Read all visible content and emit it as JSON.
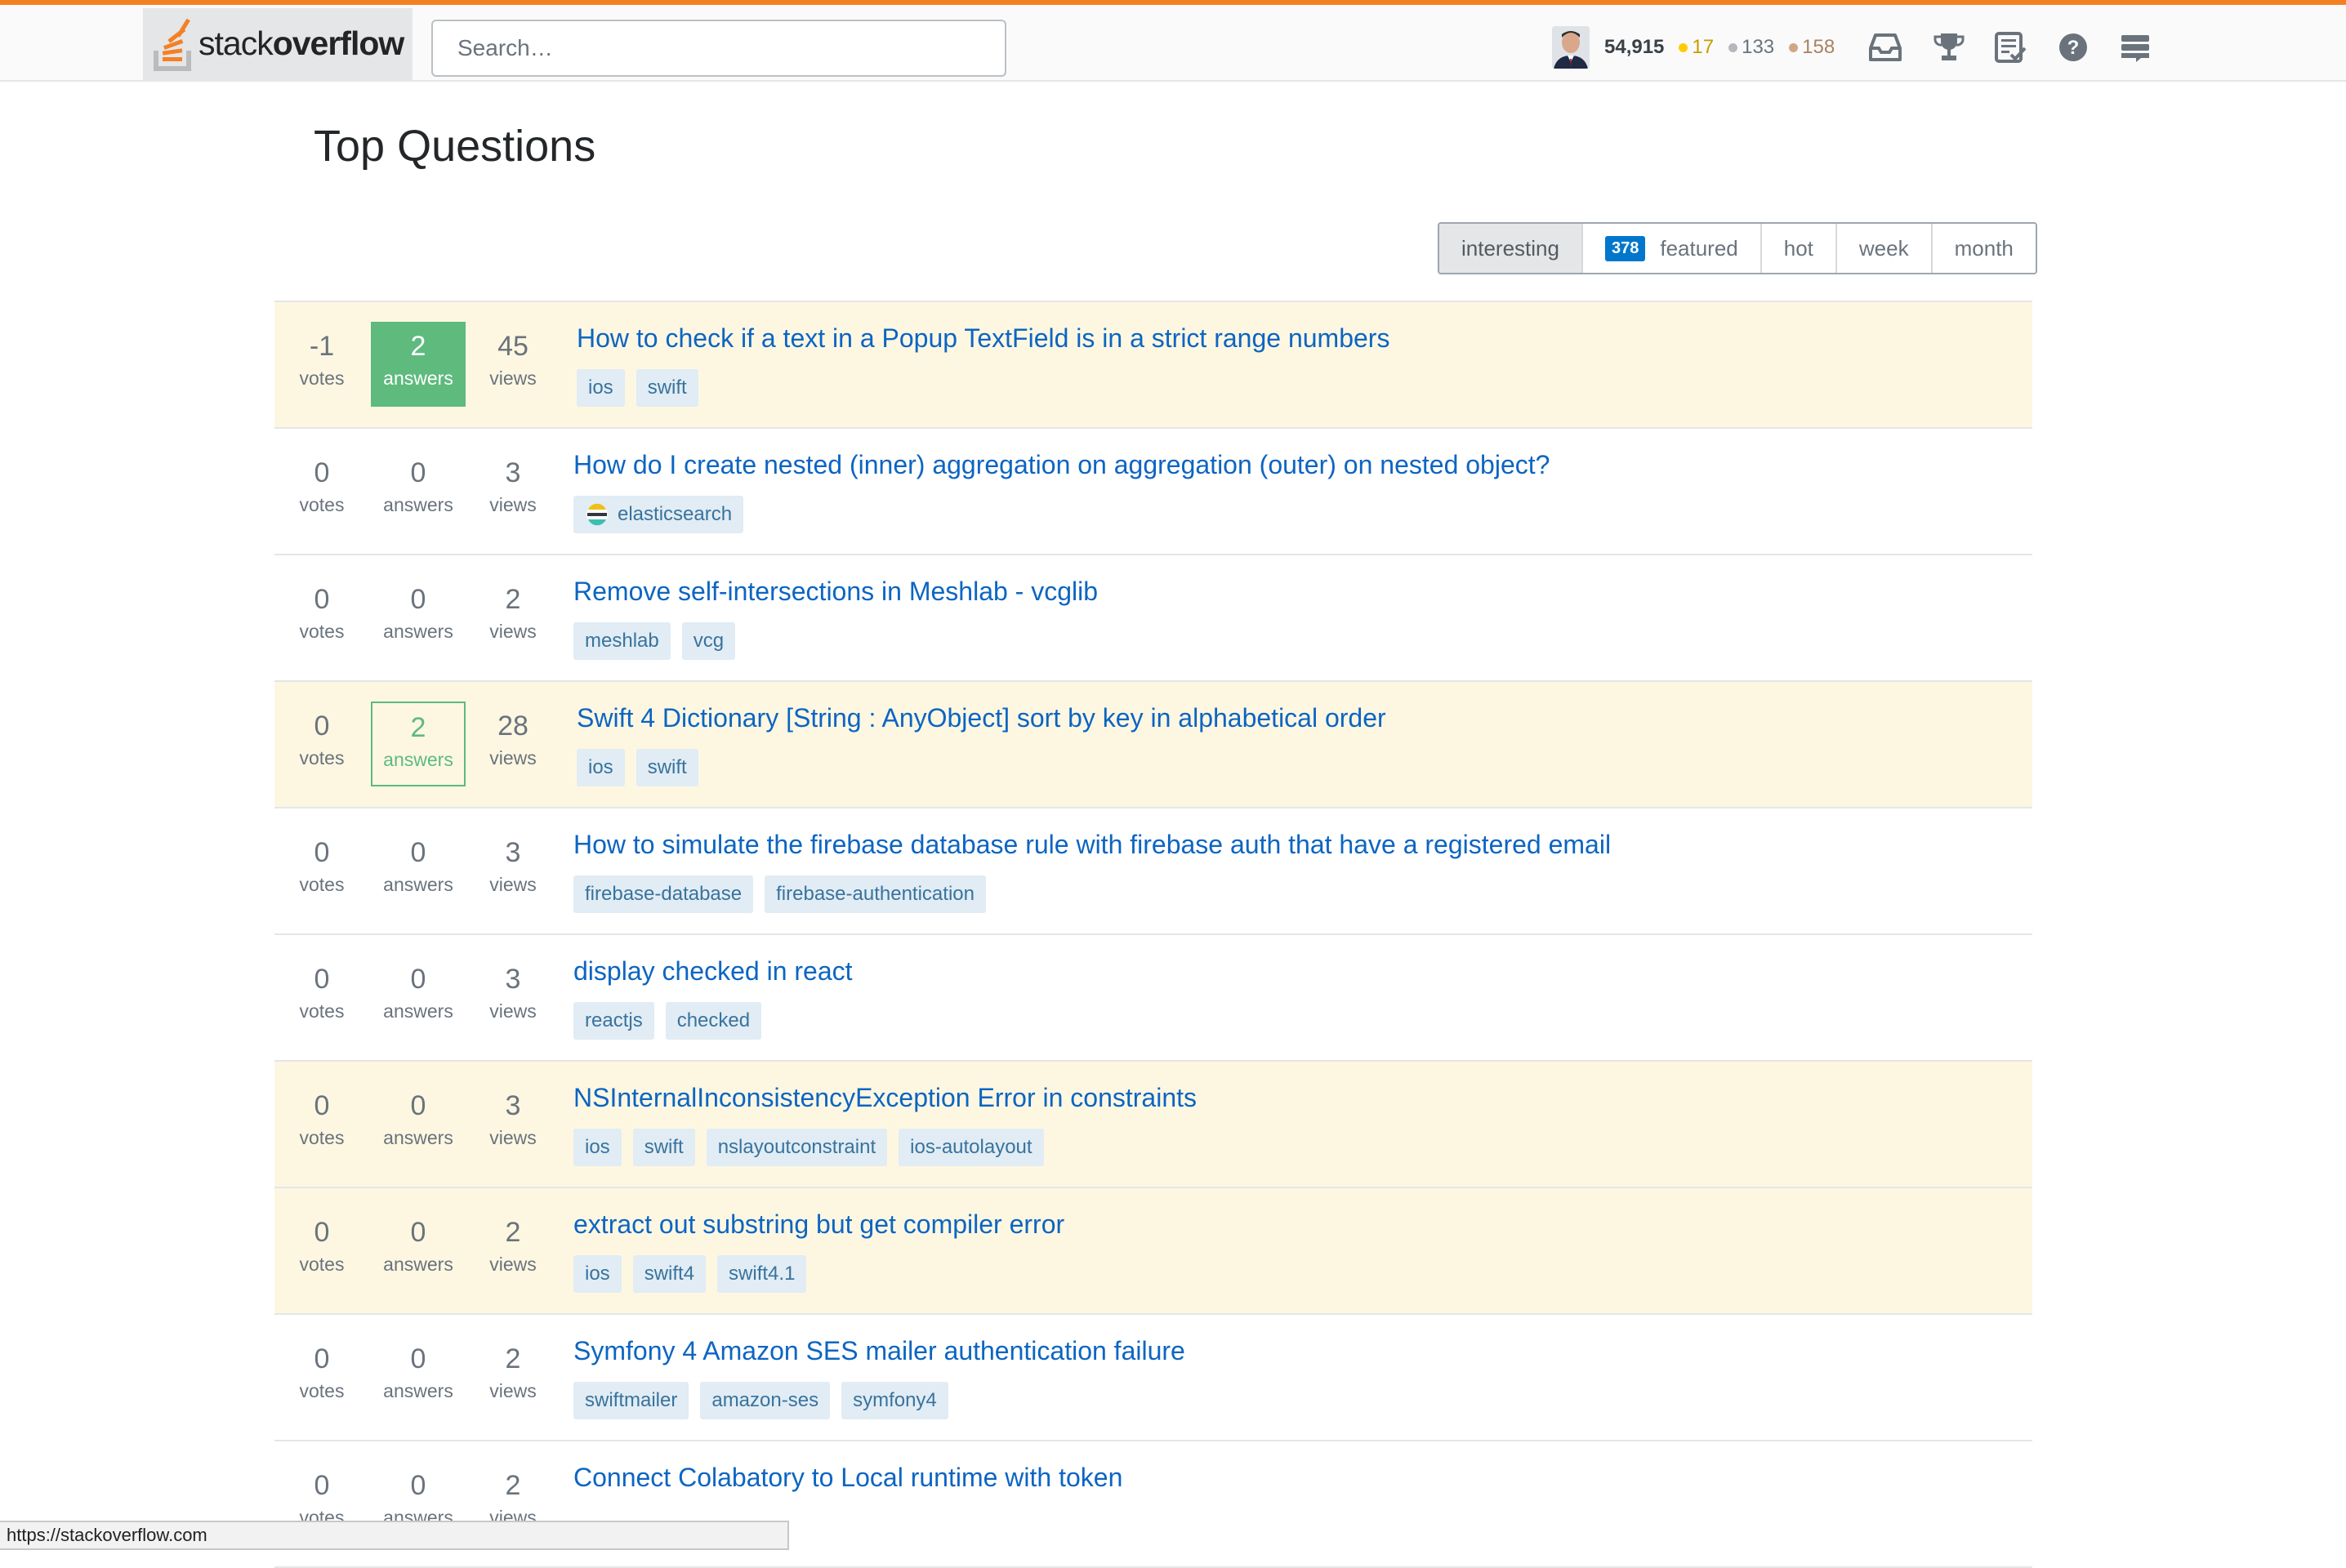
{
  "header": {
    "logo_text_light": "stack",
    "logo_text_bold": "overflow",
    "search_placeholder": "Search…",
    "user": {
      "reputation": "54,915",
      "gold": "17",
      "silver": "133",
      "bronze": "158"
    },
    "icons": [
      "inbox-icon",
      "achievements-trophy-icon",
      "review-queue-icon",
      "help-icon",
      "site-switcher-icon"
    ]
  },
  "page_title": "Top Questions",
  "tabs": [
    {
      "label": "interesting",
      "active": true
    },
    {
      "label": "featured",
      "bounty_count": "378"
    },
    {
      "label": "hot"
    },
    {
      "label": "week"
    },
    {
      "label": "month"
    }
  ],
  "questions": [
    {
      "votes": "-1",
      "answers": "2",
      "views": "45",
      "answer_state": "accepted",
      "highlight": true,
      "title": "How to check if a text in a Popup TextField is in a strict range numbers",
      "tags": [
        "ios",
        "swift"
      ]
    },
    {
      "votes": "0",
      "answers": "0",
      "views": "3",
      "answer_state": "none",
      "highlight": false,
      "title": "How do I create nested (inner) aggregation on aggregation (outer) on nested object?",
      "tags": [
        "elasticsearch"
      ]
    },
    {
      "votes": "0",
      "answers": "0",
      "views": "2",
      "answer_state": "none",
      "highlight": false,
      "title": "Remove self-intersections in Meshlab - vcglib",
      "tags": [
        "meshlab",
        "vcg"
      ]
    },
    {
      "votes": "0",
      "answers": "2",
      "views": "28",
      "answer_state": "answered",
      "highlight": true,
      "title": "Swift 4 Dictionary [String : AnyObject] sort by key in alphabetical order",
      "tags": [
        "ios",
        "swift"
      ]
    },
    {
      "votes": "0",
      "answers": "0",
      "views": "3",
      "answer_state": "none",
      "highlight": false,
      "title": "How to simulate the firebase database rule with firebase auth that have a registered email",
      "tags": [
        "firebase-database",
        "firebase-authentication"
      ]
    },
    {
      "votes": "0",
      "answers": "0",
      "views": "3",
      "answer_state": "none",
      "highlight": false,
      "title": "display checked in react",
      "tags": [
        "reactjs",
        "checked"
      ]
    },
    {
      "votes": "0",
      "answers": "0",
      "views": "3",
      "answer_state": "none",
      "highlight": true,
      "title": "NSInternalInconsistencyException Error in constraints",
      "tags": [
        "ios",
        "swift",
        "nslayoutconstraint",
        "ios-autolayout"
      ]
    },
    {
      "votes": "0",
      "answers": "0",
      "views": "2",
      "answer_state": "none",
      "highlight": true,
      "title": "extract out substring but get compiler error",
      "tags": [
        "ios",
        "swift4",
        "swift4.1"
      ]
    },
    {
      "votes": "0",
      "answers": "0",
      "views": "2",
      "answer_state": "none",
      "highlight": false,
      "title": "Symfony 4 Amazon SES mailer authentication failure",
      "tags": [
        "swiftmailer",
        "amazon-ses",
        "symfony4"
      ]
    },
    {
      "votes": "0",
      "answers": "0",
      "views": "2",
      "answer_state": "none",
      "highlight": false,
      "title": "Connect Colabatory to Local runtime with token",
      "tags": []
    }
  ],
  "labels": {
    "votes": "votes",
    "answers": "answers",
    "views": "views"
  },
  "statusbar_url": "https://stackoverflow.com",
  "colors": {
    "accent": "#f48024",
    "link": "#0c65c2",
    "tag_bg": "#e1ecf4",
    "tag_text": "#39739d",
    "accepted": "#5eba7d",
    "highlight_row": "#fdf7e2",
    "gold": "#ffcc01",
    "silver": "#b4b8bc",
    "bronze": "#d1a684"
  }
}
